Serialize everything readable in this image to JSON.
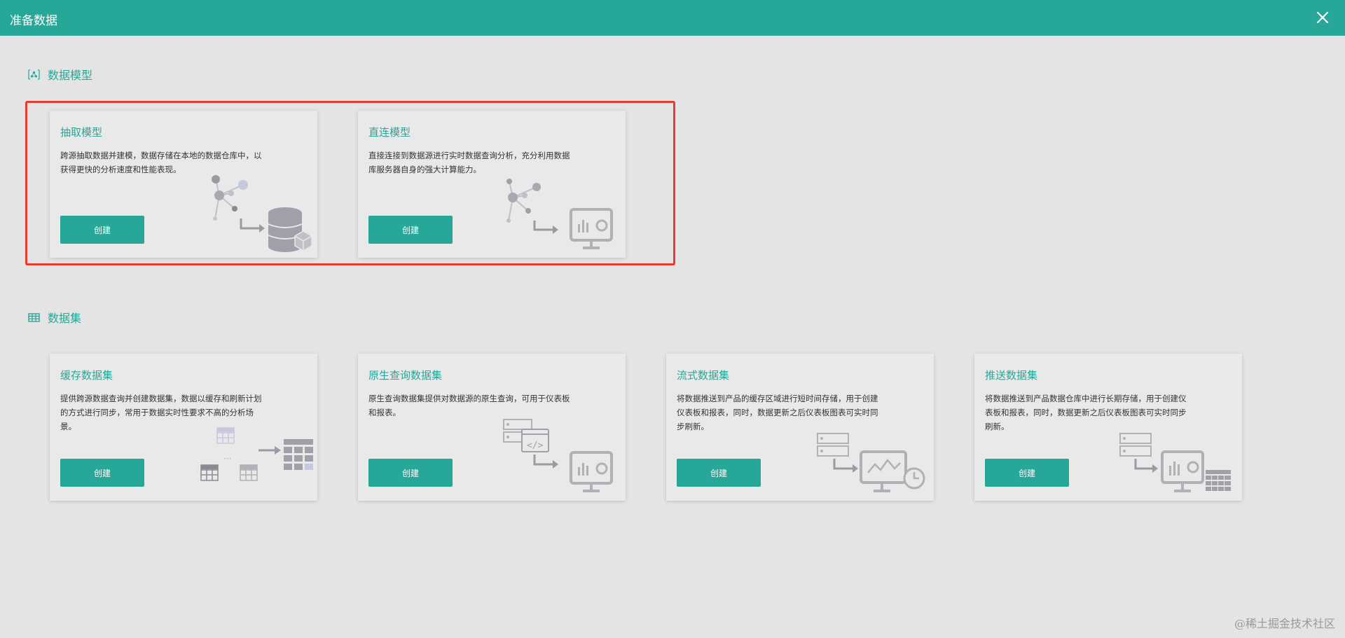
{
  "window": {
    "title": "准备数据",
    "close_icon": "close-icon"
  },
  "sections": {
    "model": {
      "label": "数据模型",
      "icon": "data-model-icon"
    },
    "dataset": {
      "label": "数据集",
      "icon": "table-icon"
    }
  },
  "cards": {
    "extract": {
      "title": "抽取模型",
      "desc": "跨源抽取数据并建模，数据存储在本地的数据仓库中，以获得更快的分析速度和性能表现。",
      "button": "创建"
    },
    "direct": {
      "title": "直连模型",
      "desc": "直接连接到数据源进行实时数据查询分析，充分利用数据库服务器自身的强大计算能力。",
      "button": "创建"
    },
    "cache": {
      "title": "缓存数据集",
      "desc": "提供跨源数据查询并创建数据集，数据以缓存和刷新计划的方式进行同步，常用于数据实时性要求不高的分析场景。",
      "button": "创建"
    },
    "native": {
      "title": "原生查询数据集",
      "desc": "原生查询数据集提供对数据源的原生查询，可用于仪表板和报表。",
      "button": "创建"
    },
    "stream": {
      "title": "流式数据集",
      "desc": "将数据推送到产品的缓存区域进行短时间存储，用于创建仪表板和报表，同时，数据更新之后仪表板图表可实时同步刷新。",
      "button": "创建"
    },
    "push": {
      "title": "推送数据集",
      "desc": "将数据推送到产品数据仓库中进行长期存储，用于创建仪表板和报表，同时，数据更新之后仪表板图表可实时同步刷新。",
      "button": "创建"
    }
  },
  "watermark": "@稀土掘金技术社区",
  "colors": {
    "accent": "#26a798",
    "highlight": "#e63a2e",
    "background": "#e4e4e4"
  }
}
